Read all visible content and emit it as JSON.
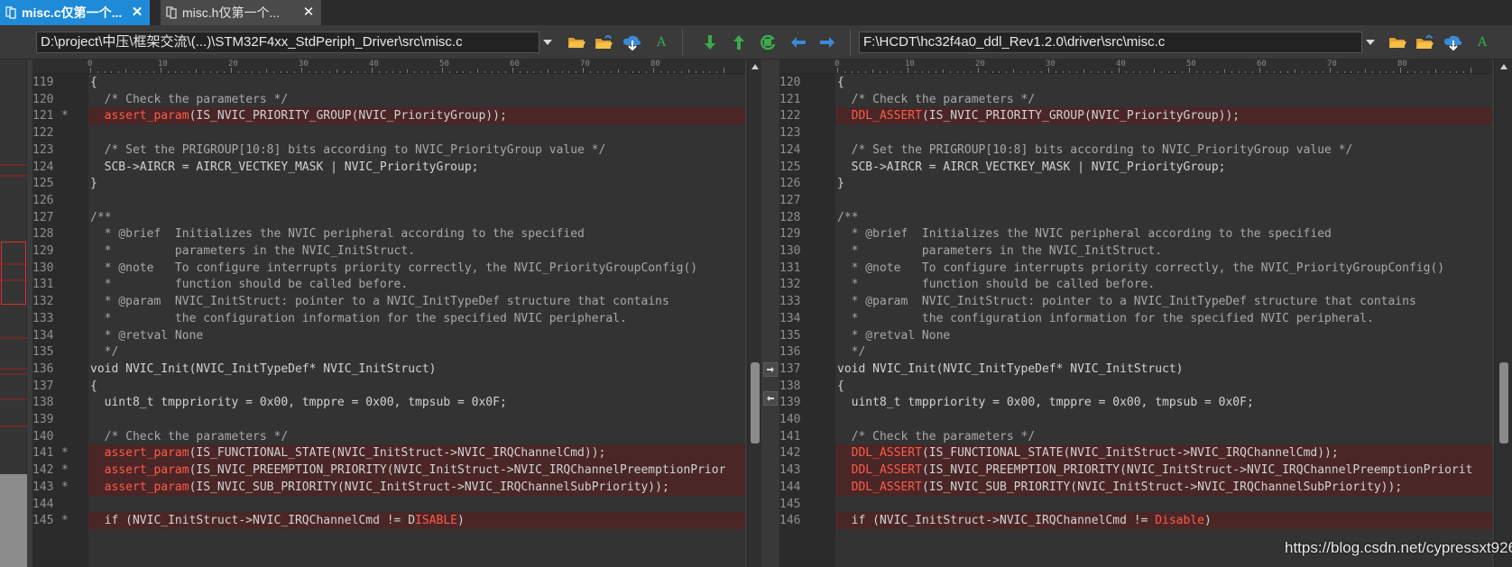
{
  "tabs": [
    {
      "label": "misc.c仅第一个...",
      "active": true
    },
    {
      "label": "misc.h仅第一个...",
      "active": false
    }
  ],
  "left": {
    "path": "D:\\project\\中压\\框架交流\\(...)\\STM32F4xx_StdPeriph_Driver\\src\\misc.c"
  },
  "right": {
    "path": "F:\\HCDT\\hc32f4a0_ddl_Rev1.2.0\\driver\\src\\misc.c"
  },
  "ruler_labels": [
    "0",
    "10",
    "20",
    "30",
    "40",
    "50",
    "60",
    "70",
    "80"
  ],
  "left_lines": [
    {
      "num": "119",
      "mark": "",
      "diff": false,
      "parts": [
        [
          "c",
          "{"
        ]
      ]
    },
    {
      "num": "120",
      "mark": "",
      "diff": false,
      "parts": [
        [
          "c",
          "  "
        ],
        [
          "m",
          "/* Check the parameters */"
        ]
      ]
    },
    {
      "num": "121",
      "mark": "*",
      "diff": true,
      "parts": [
        [
          "c",
          "  "
        ],
        [
          "r",
          "assert_param"
        ],
        [
          "c",
          "(IS_NVIC_PRIORITY_GROUP(NVIC_PriorityGroup));"
        ]
      ]
    },
    {
      "num": "122",
      "mark": "",
      "diff": false,
      "parts": []
    },
    {
      "num": "123",
      "mark": "",
      "diff": false,
      "parts": [
        [
          "c",
          "  "
        ],
        [
          "m",
          "/* Set the PRIGROUP[10:8] bits according to NVIC_PriorityGroup value */"
        ]
      ]
    },
    {
      "num": "124",
      "mark": "",
      "diff": false,
      "parts": [
        [
          "c",
          "  SCB->AIRCR = AIRCR_VECTKEY_MASK | NVIC_PriorityGroup;"
        ]
      ]
    },
    {
      "num": "125",
      "mark": "",
      "diff": false,
      "parts": [
        [
          "c",
          "}"
        ]
      ]
    },
    {
      "num": "126",
      "mark": "",
      "diff": false,
      "parts": []
    },
    {
      "num": "127",
      "mark": "",
      "diff": false,
      "parts": [
        [
          "m",
          "/**"
        ]
      ]
    },
    {
      "num": "128",
      "mark": "",
      "diff": false,
      "parts": [
        [
          "m",
          "  * @brief  Initializes the NVIC peripheral according to the specified"
        ]
      ]
    },
    {
      "num": "129",
      "mark": "",
      "diff": false,
      "parts": [
        [
          "m",
          "  *         parameters in the NVIC_InitStruct."
        ]
      ]
    },
    {
      "num": "130",
      "mark": "",
      "diff": false,
      "parts": [
        [
          "m",
          "  * @note   To configure interrupts priority correctly, the NVIC_PriorityGroupConfig()"
        ]
      ]
    },
    {
      "num": "131",
      "mark": "",
      "diff": false,
      "parts": [
        [
          "m",
          "  *         function should be called before."
        ]
      ]
    },
    {
      "num": "132",
      "mark": "",
      "diff": false,
      "parts": [
        [
          "m",
          "  * @param  NVIC_InitStruct: pointer to a NVIC_InitTypeDef structure that contains"
        ]
      ]
    },
    {
      "num": "133",
      "mark": "",
      "diff": false,
      "parts": [
        [
          "m",
          "  *         the configuration information for the specified NVIC peripheral."
        ]
      ]
    },
    {
      "num": "134",
      "mark": "",
      "diff": false,
      "parts": [
        [
          "m",
          "  * @retval None"
        ]
      ]
    },
    {
      "num": "135",
      "mark": "",
      "diff": false,
      "parts": [
        [
          "m",
          "  */"
        ]
      ]
    },
    {
      "num": "136",
      "mark": "",
      "diff": false,
      "parts": [
        [
          "c",
          "void NVIC_Init(NVIC_InitTypeDef* NVIC_InitStruct)"
        ]
      ]
    },
    {
      "num": "137",
      "mark": "",
      "diff": false,
      "parts": [
        [
          "c",
          "{"
        ]
      ]
    },
    {
      "num": "138",
      "mark": "",
      "diff": false,
      "parts": [
        [
          "c",
          "  uint8_t tmppriority = 0x00, tmppre = 0x00, tmpsub = 0x0F;"
        ]
      ]
    },
    {
      "num": "139",
      "mark": "",
      "diff": false,
      "parts": []
    },
    {
      "num": "140",
      "mark": "",
      "diff": false,
      "parts": [
        [
          "c",
          "  "
        ],
        [
          "m",
          "/* Check the parameters */"
        ]
      ]
    },
    {
      "num": "141",
      "mark": "*",
      "diff": true,
      "parts": [
        [
          "c",
          "  "
        ],
        [
          "r",
          "assert_param"
        ],
        [
          "c",
          "(IS_FUNCTIONAL_STATE(NVIC_InitStruct->NVIC_IRQChannelCmd));"
        ]
      ]
    },
    {
      "num": "142",
      "mark": "*",
      "diff": true,
      "parts": [
        [
          "c",
          "  "
        ],
        [
          "r",
          "assert_param"
        ],
        [
          "c",
          "(IS_NVIC_PREEMPTION_PRIORITY(NVIC_InitStruct->NVIC_IRQChannelPreemptionPrior"
        ]
      ]
    },
    {
      "num": "143",
      "mark": "*",
      "diff": true,
      "parts": [
        [
          "c",
          "  "
        ],
        [
          "r",
          "assert_param"
        ],
        [
          "c",
          "(IS_NVIC_SUB_PRIORITY(NVIC_InitStruct->NVIC_IRQChannelSubPriority));"
        ]
      ]
    },
    {
      "num": "144",
      "mark": "",
      "diff": false,
      "parts": []
    },
    {
      "num": "145",
      "mark": "*",
      "diff": true,
      "parts": [
        [
          "c",
          "  if (NVIC_InitStruct->NVIC_IRQChannelCmd != D"
        ],
        [
          "r",
          "ISABLE"
        ],
        [
          "c",
          ")"
        ]
      ]
    }
  ],
  "right_lines": [
    {
      "num": "120",
      "mark": "",
      "diff": false,
      "parts": [
        [
          "c",
          "{"
        ]
      ]
    },
    {
      "num": "121",
      "mark": "",
      "diff": false,
      "parts": [
        [
          "c",
          "  "
        ],
        [
          "m",
          "/* Check the parameters */"
        ]
      ]
    },
    {
      "num": "122",
      "mark": "",
      "diff": true,
      "parts": [
        [
          "c",
          "  "
        ],
        [
          "r",
          "DDL_ASSERT"
        ],
        [
          "c",
          "(IS_NVIC_PRIORITY_GROUP(NVIC_PriorityGroup));"
        ]
      ]
    },
    {
      "num": "123",
      "mark": "",
      "diff": false,
      "parts": []
    },
    {
      "num": "124",
      "mark": "",
      "diff": false,
      "parts": [
        [
          "c",
          "  "
        ],
        [
          "m",
          "/* Set the PRIGROUP[10:8] bits according to NVIC_PriorityGroup value */"
        ]
      ]
    },
    {
      "num": "125",
      "mark": "",
      "diff": false,
      "parts": [
        [
          "c",
          "  SCB->AIRCR = AIRCR_VECTKEY_MASK | NVIC_PriorityGroup;"
        ]
      ]
    },
    {
      "num": "126",
      "mark": "",
      "diff": false,
      "parts": [
        [
          "c",
          "}"
        ]
      ]
    },
    {
      "num": "127",
      "mark": "",
      "diff": false,
      "parts": []
    },
    {
      "num": "128",
      "mark": "",
      "diff": false,
      "parts": [
        [
          "m",
          "/**"
        ]
      ]
    },
    {
      "num": "129",
      "mark": "",
      "diff": false,
      "parts": [
        [
          "m",
          "  * @brief  Initializes the NVIC peripheral according to the specified"
        ]
      ]
    },
    {
      "num": "130",
      "mark": "",
      "diff": false,
      "parts": [
        [
          "m",
          "  *         parameters in the NVIC_InitStruct."
        ]
      ]
    },
    {
      "num": "131",
      "mark": "",
      "diff": false,
      "parts": [
        [
          "m",
          "  * @note   To configure interrupts priority correctly, the NVIC_PriorityGroupConfig()"
        ]
      ]
    },
    {
      "num": "132",
      "mark": "",
      "diff": false,
      "parts": [
        [
          "m",
          "  *         function should be called before."
        ]
      ]
    },
    {
      "num": "133",
      "mark": "",
      "diff": false,
      "parts": [
        [
          "m",
          "  * @param  NVIC_InitStruct: pointer to a NVIC_InitTypeDef structure that contains"
        ]
      ]
    },
    {
      "num": "134",
      "mark": "",
      "diff": false,
      "parts": [
        [
          "m",
          "  *         the configuration information for the specified NVIC peripheral."
        ]
      ]
    },
    {
      "num": "135",
      "mark": "",
      "diff": false,
      "parts": [
        [
          "m",
          "  * @retval None"
        ]
      ]
    },
    {
      "num": "136",
      "mark": "",
      "diff": false,
      "parts": [
        [
          "m",
          "  */"
        ]
      ]
    },
    {
      "num": "137",
      "mark": "",
      "diff": false,
      "parts": [
        [
          "c",
          "void NVIC_Init(NVIC_InitTypeDef* NVIC_InitStruct)"
        ]
      ]
    },
    {
      "num": "138",
      "mark": "",
      "diff": false,
      "parts": [
        [
          "c",
          "{"
        ]
      ]
    },
    {
      "num": "139",
      "mark": "",
      "diff": false,
      "parts": [
        [
          "c",
          "  uint8_t tmppriority = 0x00, tmppre = 0x00, tmpsub = 0x0F;"
        ]
      ]
    },
    {
      "num": "140",
      "mark": "",
      "diff": false,
      "parts": []
    },
    {
      "num": "141",
      "mark": "",
      "diff": false,
      "parts": [
        [
          "c",
          "  "
        ],
        [
          "m",
          "/* Check the parameters */"
        ]
      ]
    },
    {
      "num": "142",
      "mark": "",
      "diff": true,
      "parts": [
        [
          "c",
          "  "
        ],
        [
          "r",
          "DDL_ASSERT"
        ],
        [
          "c",
          "(IS_FUNCTIONAL_STATE(NVIC_InitStruct->NVIC_IRQChannelCmd));"
        ]
      ]
    },
    {
      "num": "143",
      "mark": "",
      "diff": true,
      "parts": [
        [
          "c",
          "  "
        ],
        [
          "r",
          "DDL_ASSERT"
        ],
        [
          "c",
          "(IS_NVIC_PREEMPTION_PRIORITY(NVIC_InitStruct->NVIC_IRQChannelPreemptionPriorit"
        ]
      ]
    },
    {
      "num": "144",
      "mark": "",
      "diff": true,
      "parts": [
        [
          "c",
          "  "
        ],
        [
          "r",
          "DDL_ASSERT"
        ],
        [
          "c",
          "(IS_NVIC_SUB_PRIORITY(NVIC_InitStruct->NVIC_IRQChannelSubPriority));"
        ]
      ]
    },
    {
      "num": "145",
      "mark": "",
      "diff": false,
      "parts": []
    },
    {
      "num": "146",
      "mark": "",
      "diff": true,
      "parts": [
        [
          "c",
          "  if (NVIC_InitStruct->NVIC_IRQChannelCmd != "
        ],
        [
          "r",
          "Disable"
        ],
        [
          "c",
          ")"
        ]
      ]
    }
  ],
  "watermark": "https://blog.csdn.net/cypressxt926",
  "colors": {
    "accent": "#1e8ad8",
    "diff_background": "#4a2626",
    "diff_text": "#ff5a4a",
    "comment": "#a8a8a8",
    "code": "#d2d2d2",
    "folder_icon": "#e0a030",
    "green_icon": "#3aaa4a",
    "blue_icon": "#3a8ad8"
  },
  "icons": {
    "tabs": [
      "file-compare-icon",
      "close-icon"
    ],
    "left_toolbar": [
      "open-folder-icon",
      "recent-folder-icon",
      "save-cloud-icon",
      "font-icon"
    ],
    "center_toolbar": [
      "next-diff-icon",
      "previous-diff-icon",
      "refresh-icon",
      "copy-left-icon",
      "copy-right-icon"
    ],
    "right_toolbar": [
      "open-folder-icon",
      "recent-folder-icon",
      "save-cloud-icon",
      "font-icon"
    ]
  }
}
